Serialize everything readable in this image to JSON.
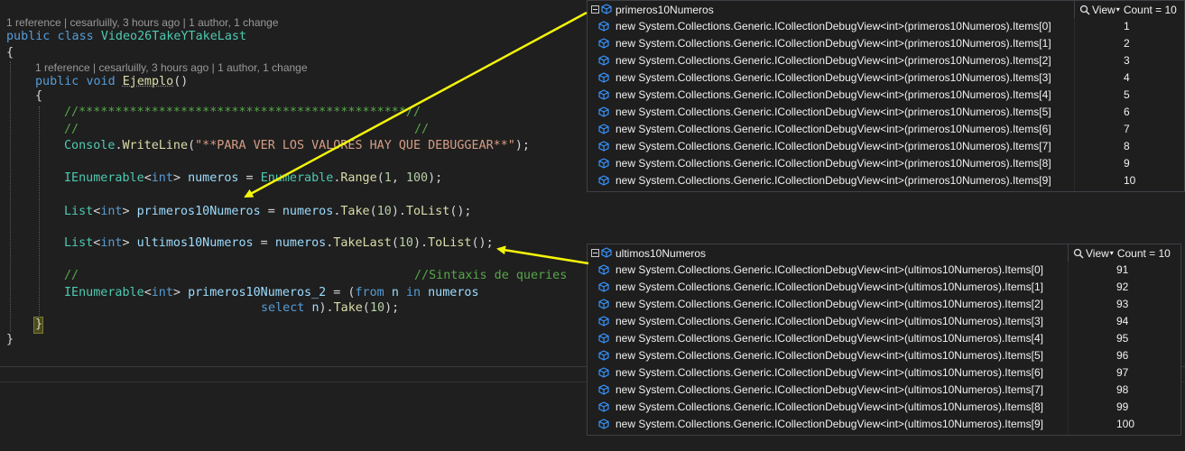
{
  "codelens": {
    "class_lens": "1 reference | cesarluilly, 3 hours ago | 1 author, 1 change",
    "method_lens": "1 reference | cesarluilly, 3 hours ago | 1 author, 1 change"
  },
  "code": {
    "kw_public": "public",
    "kw_class": "class",
    "class_name": "Video26TakeYTakeLast",
    "open_brace": "{",
    "close_brace": "}",
    "kw_void": "void",
    "method_name": "Ejemplo",
    "parens": "()",
    "comment_stars": "//*********************************************//",
    "comment_l": "//",
    "comment_r": "//",
    "console": "Console",
    "writeline": "WriteLine",
    "string_val": "\"**PARA VER LOS VALORES HAY QUE DEBUGGEAR**\"",
    "ienumerable": "IEnumerable",
    "kw_int": "int",
    "var_numeros": "numeros",
    "enumerable": "Enumerable",
    "range": "Range",
    "num_1": "1",
    "num_100": "100",
    "list": "List",
    "var_primeros": "primeros10Numeros",
    "take": "Take",
    "num_10": "10",
    "tolist": "ToList",
    "var_ultimos": "ultimos10Numeros",
    "takelast": "TakeLast",
    "comment_query": "//Sintaxis de queries",
    "var_primeros2": "primeros10Numeros_2",
    "kw_from": "from",
    "var_n": "n",
    "kw_in": "in",
    "kw_select": "select"
  },
  "popup_primeros": {
    "title": "primeros10Numeros",
    "view_label": "View",
    "count_label": "Count = 10",
    "rows": [
      {
        "expr": "new System.Collections.Generic.ICollectionDebugView<int>(primeros10Numeros).Items[0]",
        "value": "1"
      },
      {
        "expr": "new System.Collections.Generic.ICollectionDebugView<int>(primeros10Numeros).Items[1]",
        "value": "2"
      },
      {
        "expr": "new System.Collections.Generic.ICollectionDebugView<int>(primeros10Numeros).Items[2]",
        "value": "3"
      },
      {
        "expr": "new System.Collections.Generic.ICollectionDebugView<int>(primeros10Numeros).Items[3]",
        "value": "4"
      },
      {
        "expr": "new System.Collections.Generic.ICollectionDebugView<int>(primeros10Numeros).Items[4]",
        "value": "5"
      },
      {
        "expr": "new System.Collections.Generic.ICollectionDebugView<int>(primeros10Numeros).Items[5]",
        "value": "6"
      },
      {
        "expr": "new System.Collections.Generic.ICollectionDebugView<int>(primeros10Numeros).Items[6]",
        "value": "7"
      },
      {
        "expr": "new System.Collections.Generic.ICollectionDebugView<int>(primeros10Numeros).Items[7]",
        "value": "8"
      },
      {
        "expr": "new System.Collections.Generic.ICollectionDebugView<int>(primeros10Numeros).Items[8]",
        "value": "9"
      },
      {
        "expr": "new System.Collections.Generic.ICollectionDebugView<int>(primeros10Numeros).Items[9]",
        "value": "10"
      }
    ]
  },
  "popup_ultimos": {
    "title": "ultimos10Numeros",
    "view_label": "View",
    "count_label": "Count = 10",
    "rows": [
      {
        "expr": "new System.Collections.Generic.ICollectionDebugView<int>(ultimos10Numeros).Items[0]",
        "value": "91"
      },
      {
        "expr": "new System.Collections.Generic.ICollectionDebugView<int>(ultimos10Numeros).Items[1]",
        "value": "92"
      },
      {
        "expr": "new System.Collections.Generic.ICollectionDebugView<int>(ultimos10Numeros).Items[2]",
        "value": "93"
      },
      {
        "expr": "new System.Collections.Generic.ICollectionDebugView<int>(ultimos10Numeros).Items[3]",
        "value": "94"
      },
      {
        "expr": "new System.Collections.Generic.ICollectionDebugView<int>(ultimos10Numeros).Items[4]",
        "value": "95"
      },
      {
        "expr": "new System.Collections.Generic.ICollectionDebugView<int>(ultimos10Numeros).Items[5]",
        "value": "96"
      },
      {
        "expr": "new System.Collections.Generic.ICollectionDebugView<int>(ultimos10Numeros).Items[6]",
        "value": "97"
      },
      {
        "expr": "new System.Collections.Generic.ICollectionDebugView<int>(ultimos10Numeros).Items[7]",
        "value": "98"
      },
      {
        "expr": "new System.Collections.Generic.ICollectionDebugView<int>(ultimos10Numeros).Items[8]",
        "value": "99"
      },
      {
        "expr": "new System.Collections.Generic.ICollectionDebugView<int>(ultimos10Numeros).Items[9]",
        "value": "100"
      }
    ]
  },
  "icons": {
    "expander": "collapse-minus-icon",
    "object": "cube-object-icon",
    "search": "magnifier-icon",
    "dropdown": "caret-down-icon"
  },
  "colors": {
    "editor_bg": "#1f1f1f",
    "annotation_arrow": "#f5f50a",
    "object_icon": "#3794ff"
  }
}
